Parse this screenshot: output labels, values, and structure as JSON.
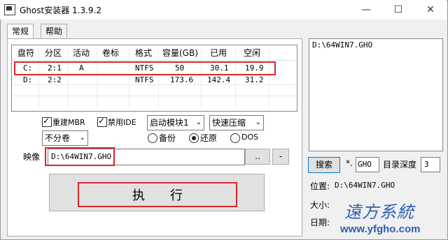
{
  "window": {
    "title": "Ghost安装器 1.3.9.2",
    "minimize": "—",
    "maximize": "☐",
    "close": "✕"
  },
  "tabs": [
    {
      "label": "常规"
    },
    {
      "label": "帮助"
    }
  ],
  "disk_table": {
    "headers": [
      "盘符",
      "分区",
      "活动",
      "卷标",
      "格式",
      "容量(GB)",
      "已用",
      "空闲"
    ],
    "rows": [
      [
        "C:",
        "2:1",
        "A",
        "",
        "NTFS",
        "50",
        "30.1",
        "19.9"
      ],
      [
        "D:",
        "2:2",
        "",
        "",
        "NTFS",
        "173.6",
        "142.4",
        "31.2"
      ]
    ]
  },
  "options": {
    "rebuild_mbr": {
      "label": "重建MBR",
      "checked": true
    },
    "disable_ide": {
      "label": "禁用IDE",
      "checked": true
    },
    "boot_module": "启动模块1",
    "compress": "快速压缩",
    "split": "不分卷",
    "mode_backup": "备份",
    "mode_restore": "还原",
    "mode_dos": "DOS",
    "selected_mode": "还原"
  },
  "image": {
    "label": "映像",
    "path": "D:\\64WIN7.GHO",
    "browse": "..",
    "minus": "-"
  },
  "execute": {
    "label": "执　　行"
  },
  "right": {
    "result_item": "D:\\64WIN7.GHO",
    "search_button": "搜索",
    "ext_prefix": "*.",
    "ext_value": "GHO",
    "depth_label": "目录深度",
    "depth_value": "3",
    "location_label": "位置:",
    "location_value": "D:\\64WIN7.GHO",
    "size_label": "大小:",
    "date_label": "日期:"
  },
  "watermark": {
    "text": "遠方系統",
    "url": "www.yfgho.com"
  }
}
